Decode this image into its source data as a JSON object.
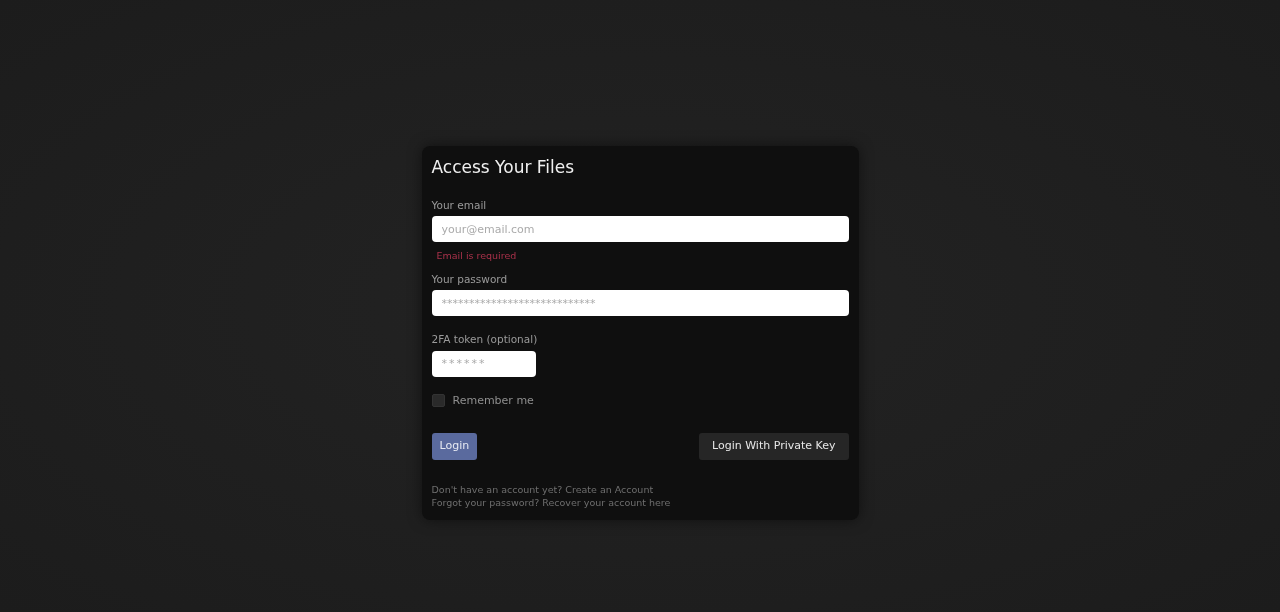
{
  "title": "Access Your Files",
  "fields": [
    {
      "label": "Your email",
      "placeholder": "your@email.com",
      "error": "Email is required",
      "kind": "email"
    },
    {
      "label": "Your password",
      "placeholder": "****************************",
      "kind": "password"
    },
    {
      "label": "2FA token (optional)",
      "placeholder": "******",
      "kind": "token"
    }
  ],
  "remember": {
    "label": "Remember me",
    "checked": false
  },
  "buttons": [
    {
      "label": "Login",
      "kind": "primary"
    },
    {
      "label": "Login With Private Key",
      "kind": "secondary"
    }
  ],
  "footer": [
    {
      "text": "Don't have an account yet? ",
      "link": "Create an Account"
    },
    {
      "text": "Forgot your password? ",
      "link": "Recover your account here"
    }
  ]
}
